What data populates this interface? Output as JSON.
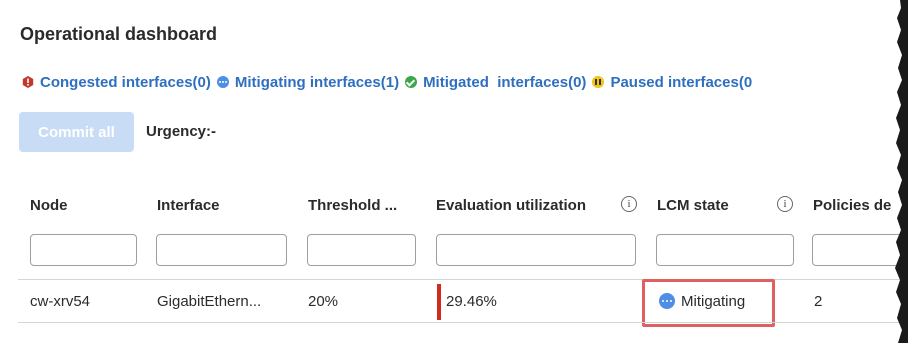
{
  "page": {
    "title": "Operational dashboard"
  },
  "status_filters": [
    {
      "label": "Congested interfaces(0)",
      "icon": "congested-icon",
      "color": "#c0392b"
    },
    {
      "label": "Mitigating interfaces(1)",
      "icon": "mitigating-icon",
      "color": "#4f8ee6"
    },
    {
      "label": "Mitigated  interfaces(0)",
      "icon": "mitigated-icon",
      "color": "#3aa84a"
    },
    {
      "label": "Paused interfaces(0",
      "icon": "paused-icon",
      "color": "#f0c419"
    }
  ],
  "toolbar": {
    "commit_label": "Commit all",
    "urgency_label": "Urgency:-"
  },
  "table": {
    "columns": [
      {
        "label": "Node",
        "has_info": false
      },
      {
        "label": "Interface",
        "has_info": false
      },
      {
        "label": "Threshold ...",
        "has_info": false
      },
      {
        "label": "Evaluation utilization",
        "has_info": true
      },
      {
        "label": "LCM state",
        "has_info": true
      },
      {
        "label": "Policies de",
        "has_info": false
      }
    ],
    "rows": [
      {
        "node": "cw-xrv54",
        "interface": "GigabitEthern...",
        "threshold": "20%",
        "evaluation_utilization": "29.46%",
        "lcm_state": "Mitigating",
        "policies": "2"
      }
    ]
  },
  "colors": {
    "accent": "#2f6fc0",
    "highlight": "#e06060",
    "util_bar": "#d22a1e"
  }
}
